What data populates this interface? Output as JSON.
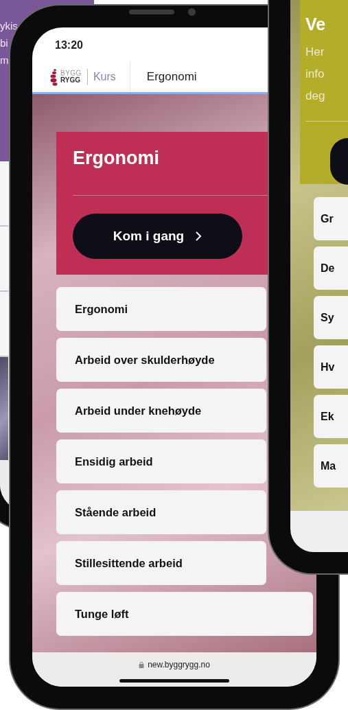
{
  "left_phone": {
    "text_lines": [
      "ykis",
      "bi",
      "m"
    ]
  },
  "center_phone": {
    "status_time": "13:20",
    "header": {
      "brand_top": "BYGG",
      "brand_bottom": "RYGG",
      "section": "Kurs",
      "page_title": "Ergonomi"
    },
    "hero": {
      "title": "Ergonomi",
      "button": "Kom i gang"
    },
    "items": [
      "Ergonomi",
      "Arbeid over skulderhøyde",
      "Arbeid under knehøyde",
      "Ensidig arbeid",
      "Stående arbeid",
      "Stillesittende arbeid",
      "Tunge løft"
    ],
    "url": "new.byggrygg.no"
  },
  "right_phone": {
    "hero": {
      "title": "Ve",
      "text_lines": [
        "Her",
        "info",
        "deg"
      ]
    },
    "items": [
      "Gr",
      "De",
      "Sy",
      "Hv",
      "Ek",
      "Ma"
    ]
  }
}
